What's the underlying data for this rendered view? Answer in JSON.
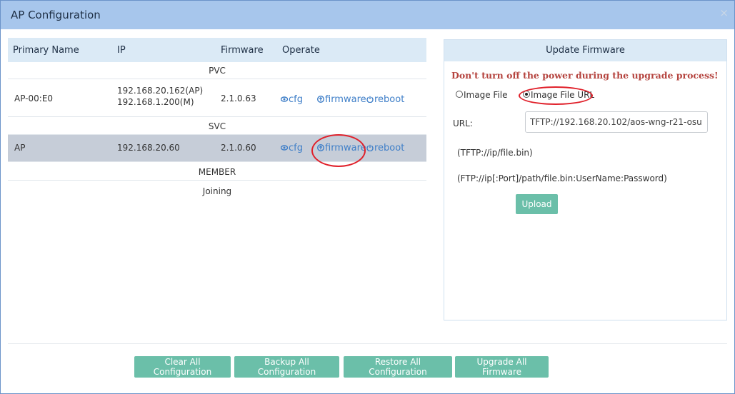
{
  "window": {
    "title": "AP Configuration",
    "close_glyph": "×"
  },
  "table": {
    "headers": {
      "name": "Primary Name",
      "ip": "IP",
      "firmware": "Firmware",
      "operate": "Operate"
    },
    "groups": {
      "pvc": "PVC",
      "svc": "SVC",
      "member": "MEMBER",
      "joining": "Joining"
    },
    "pvc_row": {
      "name": "AP-00:E0",
      "ip_ap": "192.168.20.162(AP)",
      "ip_m": "192.168.1.200(M)",
      "firmware": "2.1.0.63"
    },
    "svc_row": {
      "name": "AP",
      "ip": "192.168.20.60",
      "firmware": "2.1.0.60"
    },
    "ops": {
      "cfg": "cfg",
      "firmware": "firmware",
      "reboot": "reboot"
    }
  },
  "update_panel": {
    "title": "Update Firmware",
    "warning": "Don't turn off the power during the upgrade process!",
    "radio_image_file": "Image File",
    "radio_image_url": "Image File URL",
    "selected": "Image File URL",
    "url_label": "URL:",
    "url_value": "TFTP://192.168.20.102/aos-wng-r21-osu",
    "hint_tftp": "(TFTP://ip/file.bin)",
    "hint_ftp": "(FTP://ip[:Port]/path/file.bin:UserName:Password)",
    "upload_label": "Upload"
  },
  "footer": {
    "clear": "Clear All Configuration",
    "backup": "Backup All Configuration",
    "restore": "Restore All Configuration",
    "upgrade": "Upgrade All Firmware"
  },
  "colors": {
    "accent_button": "#6bbfa9",
    "link": "#3f7fc8",
    "warning": "#b5443f",
    "titlebar": "#a7c6ec",
    "annotation": "#e0202a"
  }
}
